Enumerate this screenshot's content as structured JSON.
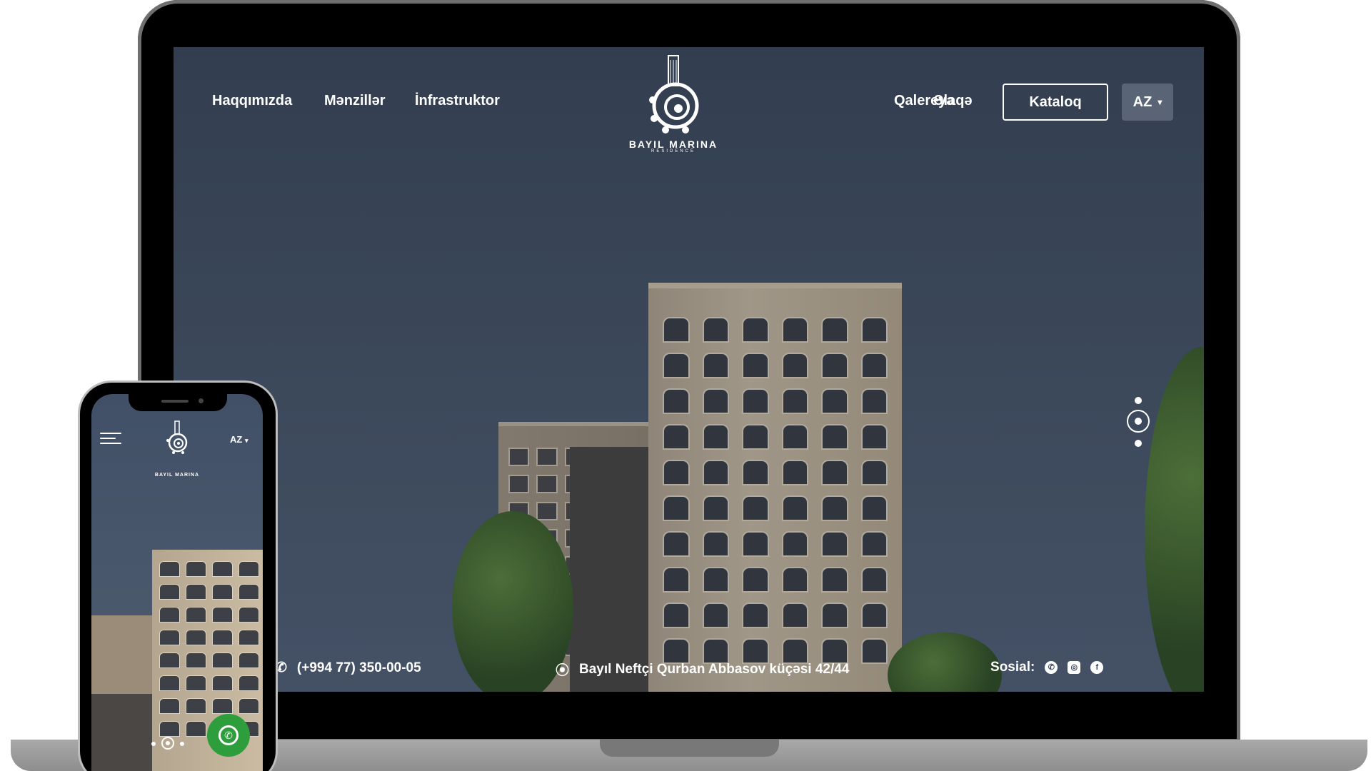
{
  "nav": {
    "left": [
      "Haqqımızda",
      "Mənzillər",
      "İnfrastruktor"
    ],
    "right": [
      "Qalereya",
      "Əlaqə"
    ],
    "catalog_label": "Kataloq",
    "language": "AZ"
  },
  "logo": {
    "name": "BAYIL MARINA",
    "sub": "RESIDENCE"
  },
  "footer": {
    "phone": "(+994 77) 350-00-05",
    "address": "Bayıl Neftçi Qurban Abbasov küçəsi 42/44",
    "social_label": "Sosial:",
    "social_icons": [
      "whatsapp-icon",
      "instagram-icon",
      "facebook-icon"
    ]
  },
  "slider": {
    "count": 3,
    "active": 2
  },
  "phone": {
    "language": "AZ",
    "logo_name": "BAYIL MARINA"
  },
  "colors": {
    "sky": "#3d4a5e",
    "whatsapp": "#2e9d3c",
    "text": "#ffffff"
  }
}
